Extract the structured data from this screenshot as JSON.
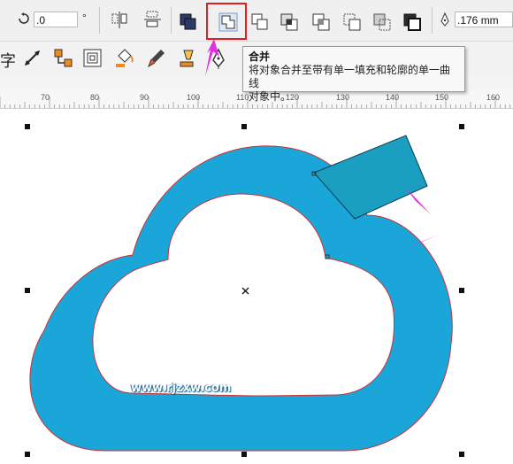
{
  "toolbar": {
    "rotation_value": ".0",
    "degree_symbol": "°",
    "outline_width_value": ".176 mm",
    "text_tool_glyph": "字"
  },
  "tooltip": {
    "title": "合并",
    "description_line1": "将对象合并至带有单一填充和轮廓的单一曲线",
    "description_line2": "对象中。"
  },
  "ruler": {
    "labels": [
      "70",
      "80",
      "90",
      "100",
      "110",
      "120",
      "130",
      "140",
      "150",
      "160"
    ]
  },
  "canvas": {
    "watermark": "www.rjzxw.com",
    "shape_fill_color": "#1aa6d8",
    "shape_outline_color": "#d03030",
    "rect_fill_color": "#1a9fc0"
  },
  "colors": {
    "highlight": "#e02020",
    "arrow": "#e030e0"
  }
}
